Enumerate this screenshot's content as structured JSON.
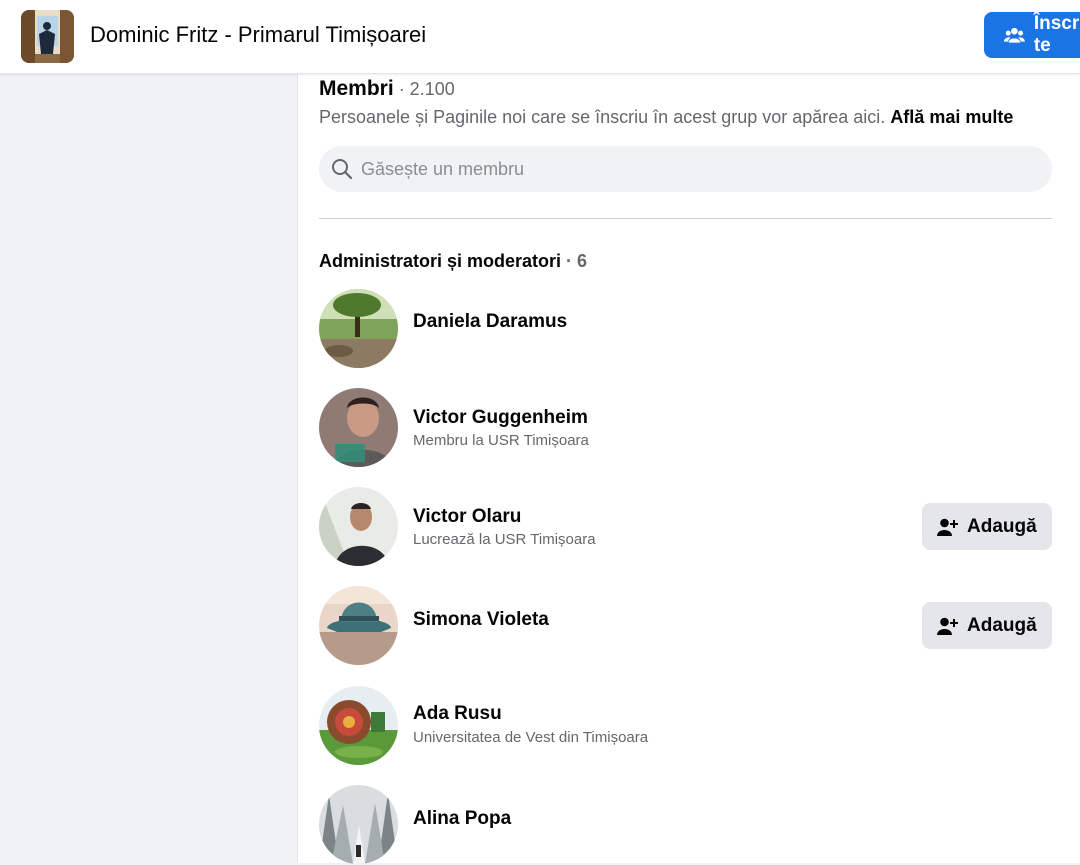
{
  "header": {
    "group_title": "Dominic Fritz - Primarul Timișoarei",
    "join_label": "Înscrie-te",
    "join_icon": "group-icon"
  },
  "members": {
    "title": "Membri",
    "count": " · 2.100",
    "description": "Persoanele și Paginile noi care se înscriu în acest grup vor apărea aici. ",
    "learn_more": "Află mai multe",
    "search_placeholder": "Găsește un membru"
  },
  "admins": {
    "title": "Administratori și moderatori",
    "count": " · 6",
    "add_label": "Adaugă",
    "people": [
      {
        "name": "Daniela Daramus",
        "subtitle": ""
      },
      {
        "name": "Victor Guggenheim",
        "subtitle": "Membru la USR Timișoara"
      },
      {
        "name": "Victor Olaru",
        "subtitle": "Lucrează la USR Timișoara"
      },
      {
        "name": "Simona Violeta",
        "subtitle": ""
      },
      {
        "name": "Ada Rusu",
        "subtitle": "Universitatea de Vest din Timișoara"
      },
      {
        "name": "Alina Popa",
        "subtitle": ""
      }
    ]
  },
  "colors": {
    "accent": "#1b74e4",
    "page_bg": "#f0f2f5",
    "secondary_text": "#65676b",
    "button_gray": "#e4e6eb"
  }
}
